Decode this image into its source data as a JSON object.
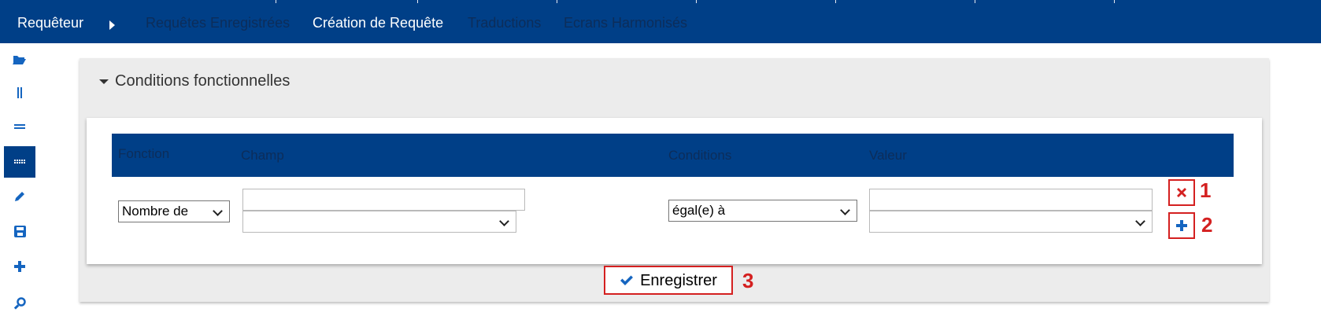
{
  "nav": {
    "brand": "Requêteur",
    "items": [
      {
        "label": "Requêtes Enregistrées",
        "state": "inactive"
      },
      {
        "label": "Création de Requête",
        "state": "active"
      },
      {
        "label": "Traductions",
        "state": "inactive"
      },
      {
        "label": "Ecrans Harmonisés",
        "state": "inactive"
      }
    ]
  },
  "sidebar": {
    "icons": [
      "folder-open-icon",
      "columns-icon",
      "rows-icon",
      "grid-icon",
      "pencil-icon",
      "save-icon",
      "plus-icon",
      "search-icon"
    ],
    "selected": "grid-icon"
  },
  "panel": {
    "title": "Conditions fonctionnelles",
    "table": {
      "headers": [
        "Fonction",
        "Champ",
        "Conditions",
        "Valeur"
      ],
      "row": {
        "fonction": "Nombre de",
        "champ_text": "",
        "champ_select": "",
        "condition": "égal(e) à",
        "valeur_text": "",
        "valeur_select": ""
      }
    },
    "actions": {
      "delete_callout": "1",
      "add_callout": "2"
    }
  },
  "save": {
    "label": "Enregistrer",
    "callout": "3"
  },
  "colors": {
    "primary": "#003f87",
    "inactive_text": "#0c2d5a",
    "callout": "#d42020",
    "delete_icon": "#d42020",
    "add_icon": "#1565c0"
  }
}
